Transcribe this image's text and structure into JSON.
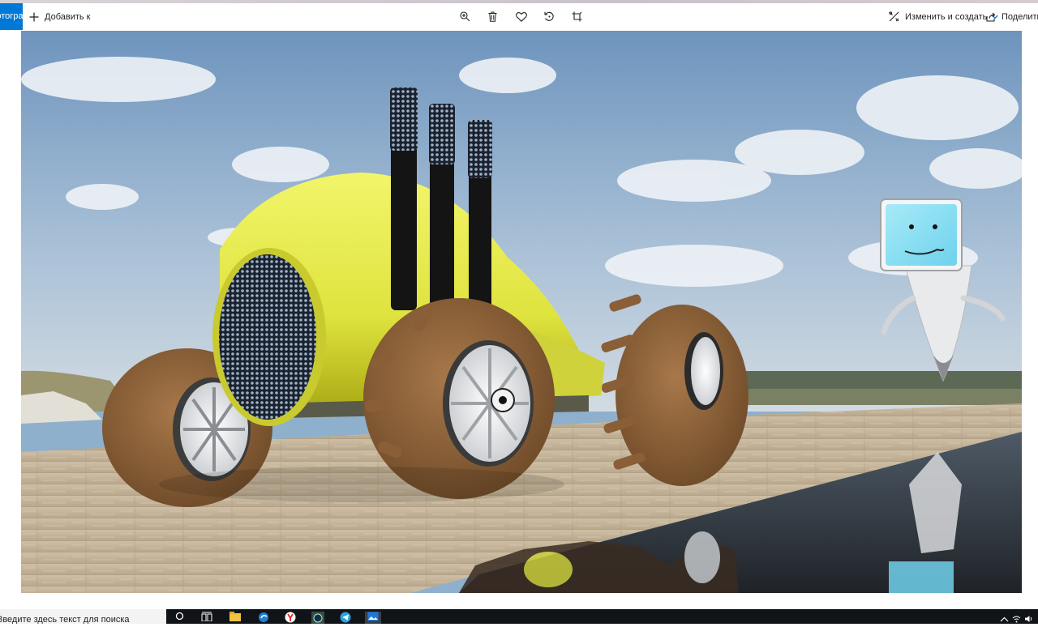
{
  "window": {
    "app_tab_label": "Фотографии"
  },
  "toolbar": {
    "add_to_label": "Добавить к",
    "edit_create_label": "Изменить и создать",
    "share_label": "Поделиться",
    "icons": [
      "zoom-icon",
      "delete-icon",
      "favorite-icon",
      "rotate-icon",
      "crop-icon"
    ],
    "accent_color": "#0078d7"
  },
  "taskbar": {
    "search_placeholder": "Введите здесь текст для поиска",
    "pinned_apps": [
      "search-icon",
      "task-view-icon",
      "file-explorer-icon",
      "edge-icon",
      "yandex-browser-icon",
      "cinema4d-icon",
      "telegram-icon",
      "photos-icon"
    ],
    "tray_icons": [
      "chevron-up-icon",
      "network-icon",
      "volume-icon"
    ]
  }
}
